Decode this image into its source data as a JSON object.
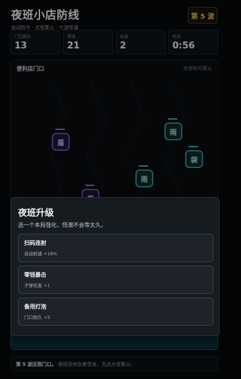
{
  "header": {
    "title": "夜班小店防线",
    "subtitle": "自动防守 · 点怪集火 · 七波怪潮",
    "wave_badge": "第 5 波"
  },
  "stats": [
    {
      "label": "门口耐久",
      "value": "13"
    },
    {
      "label": "零钱",
      "value": "21"
    },
    {
      "label": "击退",
      "value": "2"
    },
    {
      "label": "时间",
      "value": "0:56"
    }
  ],
  "board": {
    "title": "便利店门口",
    "hint": "点怪物可集火",
    "enemies": [
      {
        "glyph": "盾",
        "color": "purple"
      },
      {
        "glyph": "雨",
        "color": "teal"
      },
      {
        "glyph": "袋",
        "color": "teal"
      },
      {
        "glyph": "雨",
        "color": "teal"
      },
      {
        "glyph": "盾",
        "color": "purple"
      }
    ]
  },
  "modal": {
    "title": "夜班升级",
    "description": "选一个本局强化，怪潮不会等太久。",
    "options": [
      {
        "name": "扫码连射",
        "effect": "自动射速 +18%"
      },
      {
        "name": "零钱暴击",
        "effect": "子弹伤害 +1"
      },
      {
        "name": "备用灯泡",
        "effect": "门口耐久 +5"
      }
    ]
  },
  "message": {
    "highlight": "第 5 波压到门口。",
    "text": "夜班雨夹杂着雪发，先点大怪集火。"
  },
  "colors": {
    "accent_gold": "#d9b85a",
    "purple_enemy": "#6b48b8",
    "teal_enemy": "#2d8b86"
  }
}
